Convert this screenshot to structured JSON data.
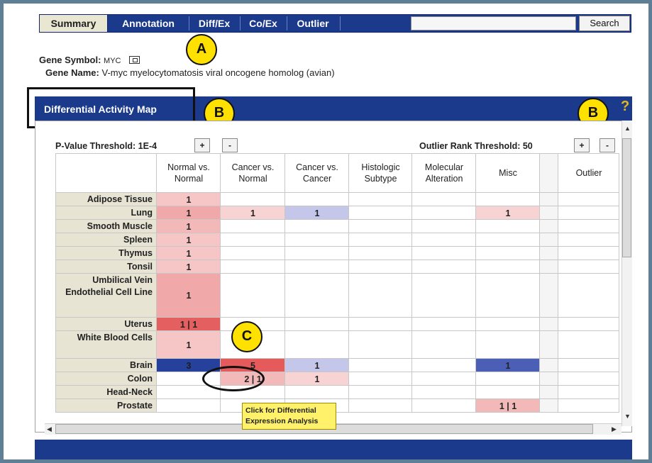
{
  "tabs": [
    "Summary",
    "Annotation",
    "Diff/Ex",
    "Co/Ex",
    "Outlier"
  ],
  "search": {
    "button_label": "Search",
    "value": ""
  },
  "gene": {
    "symbol_label": "Gene Symbol:",
    "symbol_value": "MYC",
    "name_label": "Gene Name:",
    "name_value": "V-myc myelocytomatosis viral oncogene homolog (avian)"
  },
  "callouts": {
    "a": "A",
    "b": "B",
    "c": "C"
  },
  "map": {
    "title": "Differential Activity Map",
    "help_icon": "?",
    "pvalue_threshold": "P-Value Threshold: 1E-4",
    "outlier_threshold": "Outlier Rank Threshold: 50",
    "plus": "+",
    "minus": "-",
    "columns": [
      "Normal vs. Normal",
      "Cancer vs. Normal",
      "Cancer vs. Cancer",
      "Histologic Subtype",
      "Molecular Alteration",
      "Misc",
      "",
      "Outlier"
    ],
    "rows": [
      {
        "label": "Adipose Tissue",
        "cells": [
          [
            "1",
            "#f6c6c6"
          ]
        ]
      },
      {
        "label": "Lung",
        "cells": [
          [
            "1",
            "#f0a8a8"
          ],
          [
            "1",
            "#f8d3d3"
          ],
          [
            "1",
            "#c5c7ea"
          ],
          null,
          null,
          [
            "1",
            "#f8d3d3"
          ]
        ]
      },
      {
        "label": "Smooth Muscle",
        "cells": [
          [
            "1",
            "#f3b9b9"
          ]
        ]
      },
      {
        "label": "Spleen",
        "cells": [
          [
            "1",
            "#f6c6c6"
          ]
        ]
      },
      {
        "label": "Thymus",
        "cells": [
          [
            "1",
            "#f6c6c6"
          ]
        ]
      },
      {
        "label": "Tonsil",
        "cells": [
          [
            "1",
            "#f6c6c6"
          ]
        ]
      },
      {
        "label": "Umbilical Vein Endothelial Cell Line",
        "cells": [
          [
            "1",
            "#f0a8a8"
          ]
        ]
      },
      {
        "label": "Uterus",
        "cells": [
          [
            "1 | 1",
            "#e46060"
          ]
        ]
      },
      {
        "label": "White Blood Cells",
        "cells": [
          [
            "1",
            "#f6c6c6"
          ]
        ]
      },
      {
        "label": "Brain",
        "cells": [
          [
            "3",
            "#26419b"
          ],
          [
            "5",
            "#e55a5a"
          ],
          [
            "1",
            "#c5c7ea"
          ],
          null,
          null,
          [
            "1",
            "#4a5fb5"
          ]
        ]
      },
      {
        "label": "Colon",
        "cells": [
          null,
          [
            "2 | 1",
            "#f3b9b9"
          ],
          [
            "1",
            "#f8d3d3"
          ]
        ]
      },
      {
        "label": "Head-Neck",
        "cells": []
      },
      {
        "label": "Prostate",
        "cells": [
          null,
          null,
          null,
          null,
          null,
          [
            "1 | 1",
            "#f3b9b9"
          ]
        ]
      }
    ]
  },
  "tooltip": {
    "text": "Click for Differential Expression Analysis"
  },
  "colors": {
    "nav": "#1b3a8c",
    "active_tab": "#e9e7d2",
    "callout": "#ffe100",
    "red_strong": "#e55a5a",
    "blue_strong": "#26419b"
  }
}
